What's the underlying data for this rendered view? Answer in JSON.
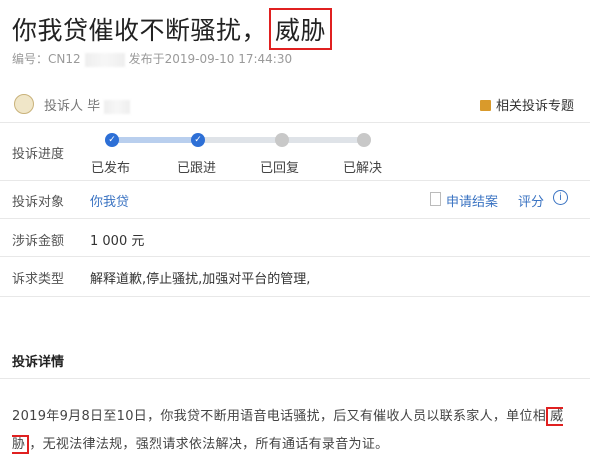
{
  "header": {
    "title_main": "你我贷催收不断骚扰，",
    "title_highlight": "威胁",
    "complaint_no_label": "编号：CN12",
    "published": "发布于2019-09-10 17:44:30"
  },
  "complainant": {
    "label": "投诉人 毕",
    "topic_link": "相关投诉专题"
  },
  "progress": {
    "label": "投诉进度",
    "steps": [
      "已发布",
      "已跟进",
      "已回复",
      "已解决"
    ],
    "completed": 2
  },
  "target": {
    "label": "投诉对象",
    "value": "你我贷",
    "apply_close": "申请结案",
    "rate": "评分",
    "info_symbol": "i"
  },
  "amount": {
    "label": "涉诉金额",
    "value": "1 000 元"
  },
  "demand": {
    "label": "诉求类型",
    "value": "解释道歉,停止骚扰,加强对平台的管理,"
  },
  "details": {
    "section_title": "投诉详情",
    "text_part1": "2019年9月8日至10日，你我贷不断用语音电话骚扰，后又有催收人员以联系家人，单位相",
    "text_highlight": "威胁",
    "text_part2": "，无视法律法规，强烈请求依法解决，所有通话有录音为证。"
  },
  "colors": {
    "accent_blue": "#2d6fd6",
    "link_blue": "#3a73c2",
    "highlight_red": "#e02020",
    "topic_orange": "#d99a2b"
  }
}
